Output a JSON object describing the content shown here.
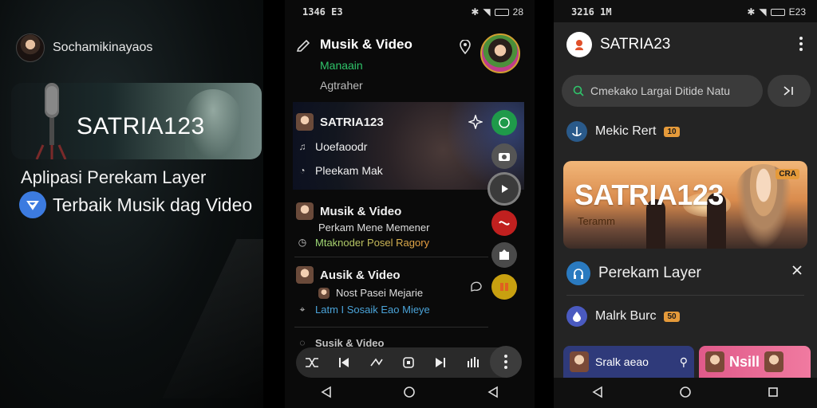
{
  "panel1": {
    "username": "Sochamikinayaos",
    "hero_title": "SATRIA123",
    "tagline_1": "Aplipasi Perekam Layer",
    "tagline_2": "Terbaik Musik dag Video"
  },
  "panel2": {
    "status_time": "1346 E3",
    "status_right": "28",
    "header_title": "Musik & Video",
    "header_sub1": "Manaain",
    "header_sub2": "Agtraher",
    "feature": {
      "title": "SATRIA123",
      "item1": "Uoefaoodr",
      "item2": "Pleekam Mak"
    },
    "entries": [
      {
        "title": "Musik & Video",
        "line1": "Perkam Mene Memener",
        "line2": "Mtaknoder Posel Ragory"
      },
      {
        "title": "Ausik & Video",
        "line1": "Nost Pasei Mejarie",
        "line2": "Latm I Sosaik Eao Mieye"
      },
      {
        "title": "Susik & Video"
      }
    ],
    "fab_colors": [
      "#1f9a4a",
      "#555555",
      "#3b3b3b",
      "#c0201f",
      "#4a4a4a",
      "#c8a010"
    ]
  },
  "panel3": {
    "status_time": "3216 1M",
    "status_right": "E23",
    "app_title": "SATRIA23",
    "search_placeholder": "Cmekako Largai Ditide Natu",
    "section1_label": "Mekic Rert",
    "section1_badge": "10",
    "banner_title": "SATRIA123",
    "banner_sub": "Teramm",
    "banner_badge": "CRA",
    "section2_label": "Perekam Layer",
    "section3_label": "Malrk Burc",
    "section3_badge": "50",
    "card1_label": "Sralk aeao",
    "card2_label": "Nsill"
  },
  "colors": {
    "accent_green": "#2fc46a",
    "accent_blue": "#3c7be0",
    "badge_orange": "#e59a3a"
  }
}
